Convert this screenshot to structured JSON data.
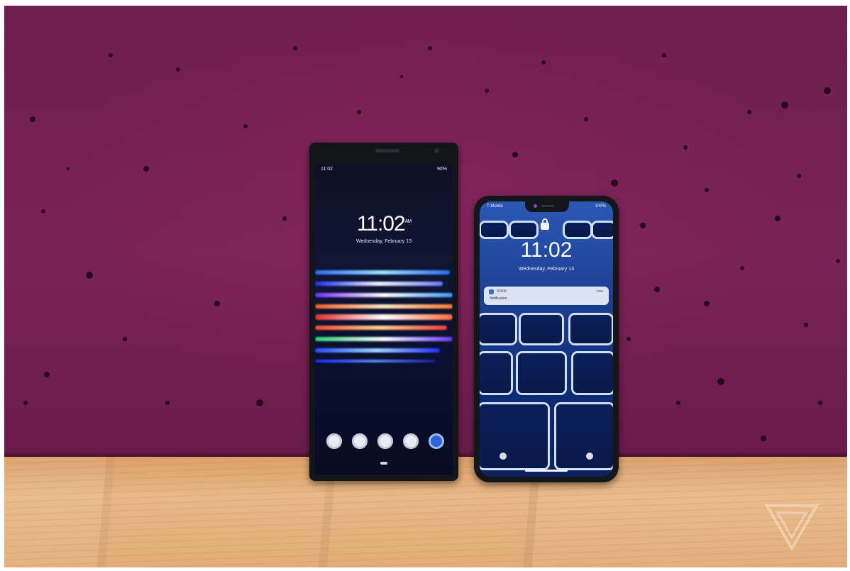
{
  "sony": {
    "status_time": "11:02",
    "status_battery": "90%",
    "clock": "11:02",
    "clock_suffix": "AM",
    "date": "Wednesday, February 13"
  },
  "iphone": {
    "carrier": "T-Mobile",
    "status_right": "100%",
    "clock": "11:02",
    "date": "Wednesday, February 13",
    "notification": {
      "app": "SPAM",
      "time": "now",
      "body": "Notification"
    }
  },
  "colors": {
    "wall": "#6d1d4e",
    "floor": "#e2ad78",
    "sony_screen": "#0c1026",
    "iphone_screen": "#1c3f93"
  }
}
